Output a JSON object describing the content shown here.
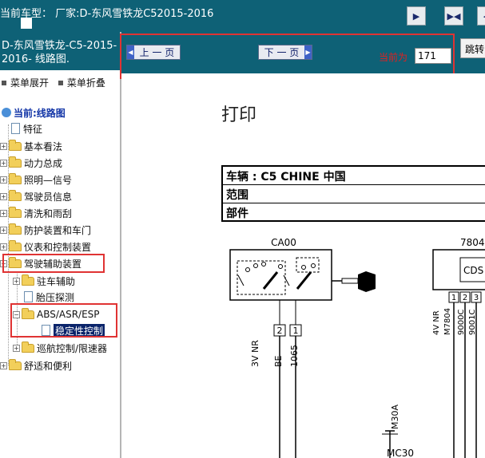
{
  "top": {
    "title": "当前车型：  厂家:D-东风雪铁龙C52015-2016",
    "buttons": [
      {
        "name": "collapse-left-button",
        "glyph": "▶"
      },
      {
        "name": "toggle-split-button",
        "glyph": "▶◀"
      },
      {
        "name": "expand-right-button",
        "glyph": "◀"
      }
    ]
  },
  "sidebar": {
    "brand": "D-东风雪铁龙-C5-2015-2016- 线路图.",
    "expand_all": "菜单展开",
    "collapse_all": "菜单折叠",
    "root": "当前:线路图",
    "items": [
      {
        "label": "特征",
        "kind": "doc"
      },
      {
        "label": "基本看法",
        "kind": "folder"
      },
      {
        "label": "动力总成",
        "kind": "folder"
      },
      {
        "label": "照明—信号",
        "kind": "folder"
      },
      {
        "label": "驾驶员信息",
        "kind": "folder"
      },
      {
        "label": "清洗和雨刮",
        "kind": "folder"
      },
      {
        "label": "防护装置和车门",
        "kind": "folder"
      },
      {
        "label": "仪表和控制装置",
        "kind": "folder"
      },
      {
        "label": "驾驶辅助装置",
        "kind": "folder",
        "expanded": true
      }
    ],
    "sub_items": [
      {
        "label": "驻车辅助",
        "kind": "folder"
      },
      {
        "label": "胎压探测",
        "kind": "doc"
      },
      {
        "label": "ABS/ASR/ESP",
        "kind": "folder",
        "expanded": true
      },
      {
        "label": "稳定性控制",
        "kind": "doc",
        "selected": true
      },
      {
        "label": "巡航控制/限速器",
        "kind": "folder"
      }
    ],
    "last_item": {
      "label": "舒适和便利",
      "kind": "folder"
    }
  },
  "viewer": {
    "prev_label": "上 一 页",
    "next_label": "下 一 页",
    "current_label": "当前为",
    "current_page": "171",
    "jump_label": "跳转",
    "print_title": "打印",
    "info": {
      "vehicle": "车辆 : C5 CHINE 中国",
      "scope": "范围",
      "part": "部件"
    },
    "diagram": {
      "connector_left": "CA00",
      "connector_right": "7804",
      "cds_label": "CDS",
      "pins_left": [
        "2",
        "1"
      ],
      "pins_right": [
        "1",
        "2",
        "3"
      ],
      "wires_left": [
        "3V NR",
        "BE",
        "1065"
      ],
      "wires_right": [
        "4V NR",
        "M7804",
        "9000C",
        "9001C"
      ],
      "ground": "M30A",
      "ground_label": "MC30"
    }
  },
  "colors": {
    "header_bg": "#0e6176",
    "highlight_red": "#e03333",
    "selected_bg": "#0a246a"
  }
}
